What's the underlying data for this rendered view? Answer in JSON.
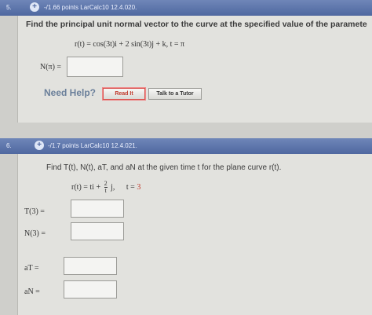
{
  "q5": {
    "number": "5.",
    "points": "-/1.66 points LarCalc10 12.4.020.",
    "prompt": "Find the principal unit normal vector to the curve at the specified value of the paramete",
    "equation": "r(t) = cos(3t)i + 2 sin(3t)j + k,    t = π",
    "answer_label": "N(π) =",
    "answer_value": "",
    "need_help": "Need Help?",
    "read_it": "Read It",
    "talk_tutor": "Talk to a Tutor"
  },
  "q6": {
    "number": "6.",
    "points": "-/1.7 points LarCalc10 12.4.021.",
    "prompt": "Find T(t), N(t), aT, and aN at the given time t for the plane curve r(t).",
    "equation_left": "r(t) = ti +",
    "fraction_top": "2",
    "fraction_bottom": "t",
    "equation_right": "j,",
    "time_label": "t =",
    "time_value": "3",
    "fields": [
      {
        "label": "T(3) =",
        "value": ""
      },
      {
        "label": "N(3) =",
        "value": ""
      },
      {
        "label": "aT =",
        "value": ""
      },
      {
        "label": "aN =",
        "value": ""
      }
    ]
  }
}
